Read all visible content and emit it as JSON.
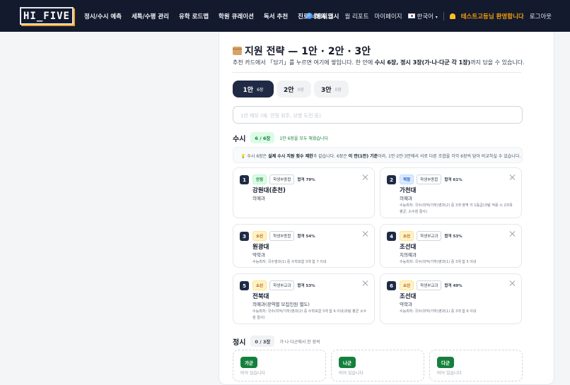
{
  "header": {
    "logo": "HI_FIVE",
    "nav": [
      "정시/수시 예측",
      "세특/수행 관리",
      "유학 로드맵",
      "학원 큐레이션",
      "독서 추천",
      "진로 네트워크"
    ],
    "right": {
      "study_abroad": "해외 입시",
      "monthly_report": "월 리포트",
      "mypage": "마이페이지",
      "language": "한국어",
      "welcome": "테스트고등님 환영합니다",
      "logout": "로그아웃"
    }
  },
  "panel": {
    "title": "지원 전략 — 1안 · 2안 · 3안",
    "subtitle_pre": "추천 카드에서 「담기」를 누르면 여기에 쌓입니다. 한 안에 ",
    "subtitle_bold": "수시 6장, 정시 3장(가·나·다군 각 1장)",
    "subtitle_post": "까지 담을 수 있습니다.",
    "tabs": [
      {
        "label": "1안",
        "count": "6장"
      },
      {
        "label": "2안",
        "count": "0장"
      },
      {
        "label": "3안",
        "count": "0장"
      }
    ],
    "memo_placeholder": "1안 메모 (예: 안정 위주, 상향 도전 등)",
    "susi": {
      "heading": "수시",
      "badge": "6 / 6장",
      "note": "1안 6장을 모두 채웠습니다",
      "info_pre": "수시 6장은 ",
      "info_b1": "실제 수시 지원 횟수 제한",
      "info_mid": "과 같습니다. 6장은 ",
      "info_b2": "이 안(1안) 기준",
      "info_post": "이라, 1안·2안·3안에서 서로 다른 조합을 각각 6장씩 담아 비교하실 수 있습니다."
    },
    "cards": [
      {
        "n": "1",
        "level": "안정",
        "level_class": "safe",
        "type": "학생부종합",
        "prob": "합격 79%",
        "univ": "강원대(춘천)",
        "dept": "의예과",
        "req": ""
      },
      {
        "n": "2",
        "level": "적정",
        "level_class": "fit",
        "type": "학생부종합",
        "prob": "합격 61%",
        "univ": "가천대",
        "dept": "의예과",
        "req": "수능최저: 국수(미적/기하)영과(2) 중 3개 영역 각 1등급(과탐 적용 시 2과목 평균, 소수점 절사)"
      },
      {
        "n": "3",
        "level": "소신",
        "level_class": "reach",
        "type": "학생부종합",
        "prob": "합격 54%",
        "univ": "원광대",
        "dept": "약학과",
        "req": "수능최저: 국수영과(1) 중 수학포함 3개 합 7 이내"
      },
      {
        "n": "4",
        "level": "소신",
        "level_class": "reach",
        "type": "학생부교과",
        "prob": "합격 53%",
        "univ": "조선대",
        "dept": "치의예과",
        "req": "수능최저: 국수(미적/기하)영과(1) 중 3개 합 5 이내"
      },
      {
        "n": "5",
        "level": "소신",
        "level_class": "reach",
        "type": "학생부교과",
        "prob": "합격 53%",
        "univ": "전북대",
        "dept": "의예과(광역별 모집인원 별도)",
        "req": "수능최저: 국수(미적/기하)영과(2) 중 수학포함 3개 합 6 이내(과탐 평균 소수점 절사)"
      },
      {
        "n": "6",
        "level": "소신",
        "level_class": "reach",
        "type": "학생부교과",
        "prob": "합격 49%",
        "univ": "조선대",
        "dept": "약학과",
        "req": "수능최저: 국수(미적/기하)영과(1) 중 3개 합 6 이내"
      }
    ],
    "jeongsi": {
      "heading": "정시",
      "badge": "0 / 3장",
      "note": "가·나·다군에서 한 장씩",
      "groups": [
        {
          "label": "가군",
          "empty": "비어 있습니다"
        },
        {
          "label": "나군",
          "empty": "비어 있습니다"
        },
        {
          "label": "다군",
          "empty": "비어 있습니다"
        }
      ]
    }
  }
}
